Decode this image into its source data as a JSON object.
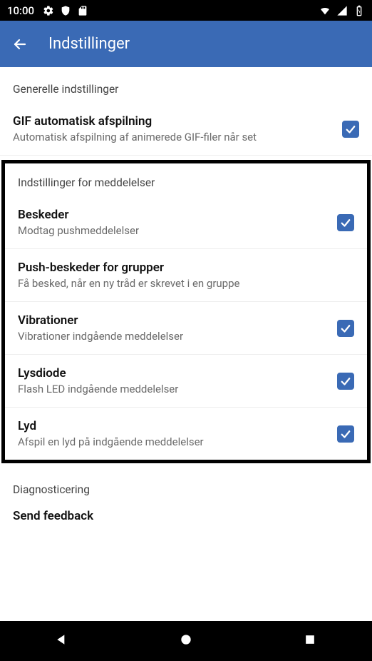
{
  "status": {
    "time": "10:00"
  },
  "appbar": {
    "title": "Indstillinger"
  },
  "general": {
    "header": "Generelle indstillinger",
    "gif": {
      "title": "GIF automatisk afspilning",
      "sub": "Automatisk afspilning af animerede GIF-filer når set",
      "checked": true
    }
  },
  "notifications": {
    "header": "Indstillinger for meddelelser",
    "messages": {
      "title": "Beskeder",
      "sub": "Modtag pushmeddelelser",
      "checked": true
    },
    "group_push": {
      "title": "Push-beskeder for grupper",
      "sub": "Få besked, når en ny tråd er skrevet i en gruppe"
    },
    "vibrations": {
      "title": "Vibrationer",
      "sub": "Vibrationer indgående meddelelser",
      "checked": true
    },
    "led": {
      "title": "Lysdiode",
      "sub": "Flash LED indgående meddelelser",
      "checked": true
    },
    "sound": {
      "title": "Lyd",
      "sub": "Afspil en lyd på indgående meddelelser",
      "checked": true
    }
  },
  "diagnostics": {
    "header": "Diagnosticering",
    "feedback": "Send feedback"
  }
}
